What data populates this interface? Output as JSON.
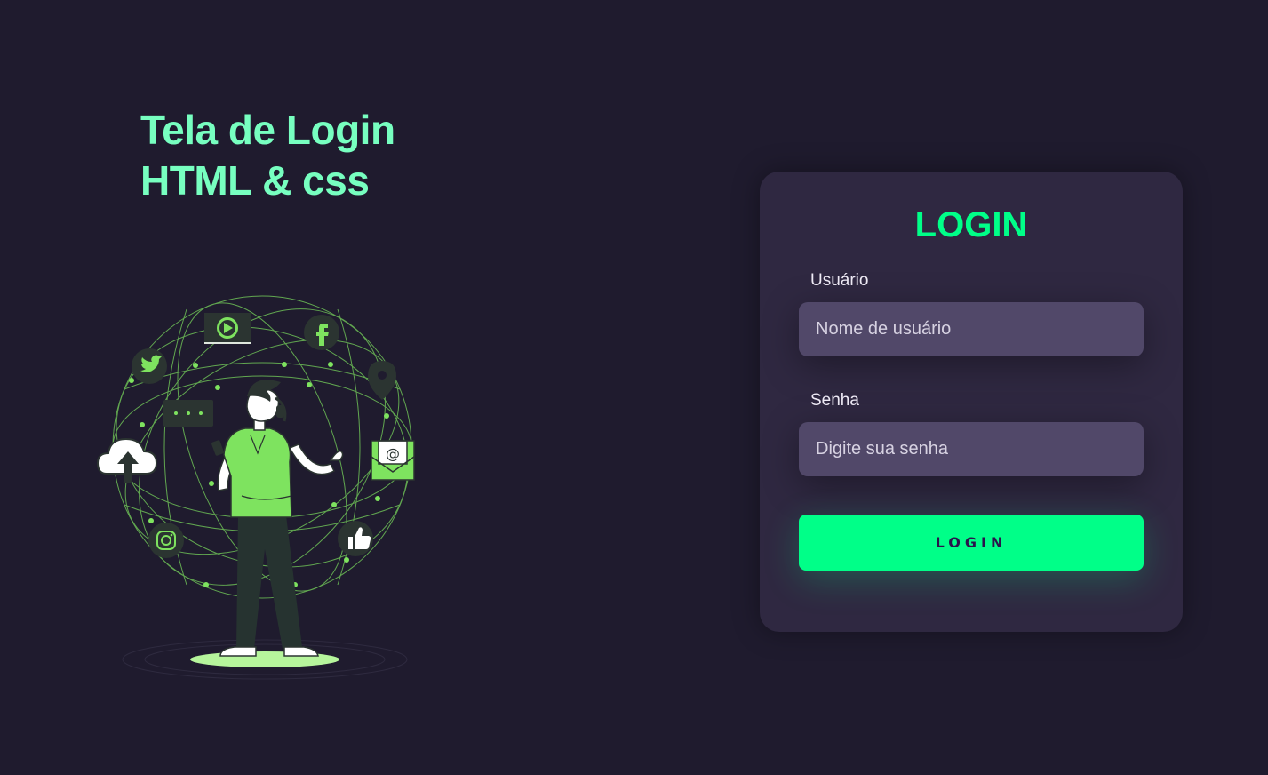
{
  "hero": {
    "line1": "Tela de Login",
    "line2": "HTML & css"
  },
  "login_card": {
    "title": "LOGIN",
    "username_label": "Usuário",
    "username_placeholder": "Nome de usuário",
    "password_label": "Senha",
    "password_placeholder": "Digite sua senha",
    "submit_label": "LOGIN"
  },
  "illustration": {
    "icons": [
      "twitter-icon",
      "play-icon",
      "facebook-icon",
      "location-pin-icon",
      "chat-icon",
      "cloud-upload-icon",
      "email-icon",
      "instagram-icon",
      "thumbs-up-icon"
    ]
  },
  "colors": {
    "background": "#1f1b2e",
    "card": "#2f2841",
    "input": "#514869",
    "accent": "#00ff88",
    "hero_text": "#77ffc0"
  }
}
